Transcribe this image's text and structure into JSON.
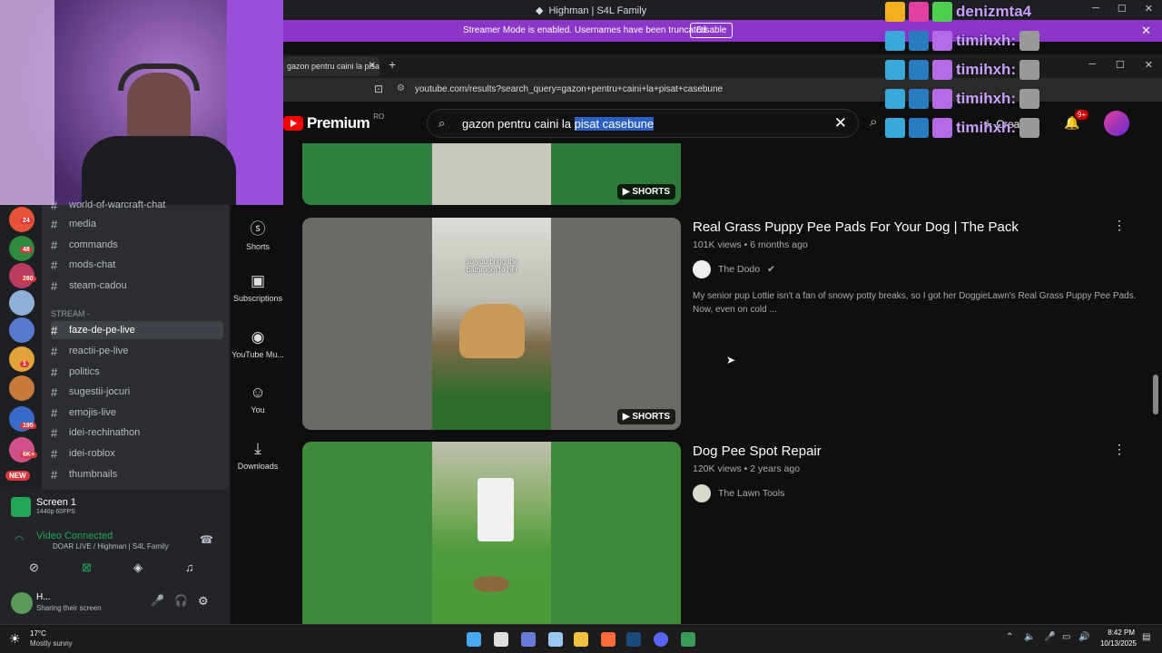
{
  "window": {
    "title": "Highman | S4L Family"
  },
  "streamer_banner": {
    "text": "Streamer Mode is enabled. Usernames have been truncated.",
    "button": "Disable"
  },
  "browser": {
    "tab_title": "gazon pentru caini la pisat",
    "url": "youtube.com/results?search_query=gazon+pentru+caini+la+pisat+casebune"
  },
  "youtube": {
    "brand": "Premium",
    "region": "RO",
    "search_query": "gazon pentru caini la ",
    "search_query_selected": "pisat casebune",
    "create_label": "Crea",
    "notif_count": "9+",
    "sidebar": [
      {
        "label": "Shorts",
        "icon": "shorts-icon"
      },
      {
        "label": "Subscriptions",
        "icon": "subscriptions-icon"
      },
      {
        "label": "YouTube Mu...",
        "icon": "youtube-music-icon"
      },
      {
        "label": "You",
        "icon": "you-icon"
      },
      {
        "label": "Downloads",
        "icon": "download-icon"
      }
    ],
    "shorts_label": "SHORTS",
    "results": [
      {
        "title": "Real Grass Puppy Pee Pads For Your Dog | The Pack",
        "meta": "101K views • 6 months ago",
        "channel": "The Dodo",
        "verified": true,
        "description": "My senior pup Lottie isn't a fan of snowy potty breaks, so I got her DoggieLawn's Real Grass Puppy Pee Pads. Now, even on cold ...",
        "overlay": "so you bring the bathroom to her"
      },
      {
        "title": "Dog Pee Spot Repair",
        "meta": "120K views • 2 years ago",
        "channel": "The Lawn Tools"
      }
    ]
  },
  "twitch_chat": {
    "names": [
      "denizmta4",
      "timihxh:",
      "timihxh:",
      "timihxh:",
      "timihxh:"
    ]
  },
  "discord": {
    "channels": [
      {
        "name": "world-of-warcraft-chat"
      },
      {
        "name": "media"
      },
      {
        "name": "commands"
      },
      {
        "name": "mods-chat"
      },
      {
        "name": "steam-cadou"
      },
      {
        "name": "faze-de-pe-live"
      },
      {
        "name": "reactii-pe-live"
      },
      {
        "name": "politics"
      },
      {
        "name": "sugestii-jocuri"
      },
      {
        "name": "emojis-live"
      },
      {
        "name": "idei-rechinathon"
      },
      {
        "name": "idei-roblox"
      },
      {
        "name": "thumbnails"
      }
    ],
    "category": "STREAM -",
    "server_badges": [
      "24",
      "48",
      "260",
      "1",
      "195",
      "6K+",
      "NEW"
    ],
    "screen": {
      "title": "Screen 1",
      "sub": "1440p 60FPS"
    },
    "voice": {
      "status": "Video Connected",
      "channel": "DOAR LIVE / Highman | S4L Family"
    },
    "user": {
      "name": "H...",
      "status": "Sharing their screen"
    }
  },
  "taskbar": {
    "weather_temp": "17°C",
    "weather_desc": "Mostly sunny",
    "time": "8:42 PM",
    "date": "10/13/2025"
  }
}
